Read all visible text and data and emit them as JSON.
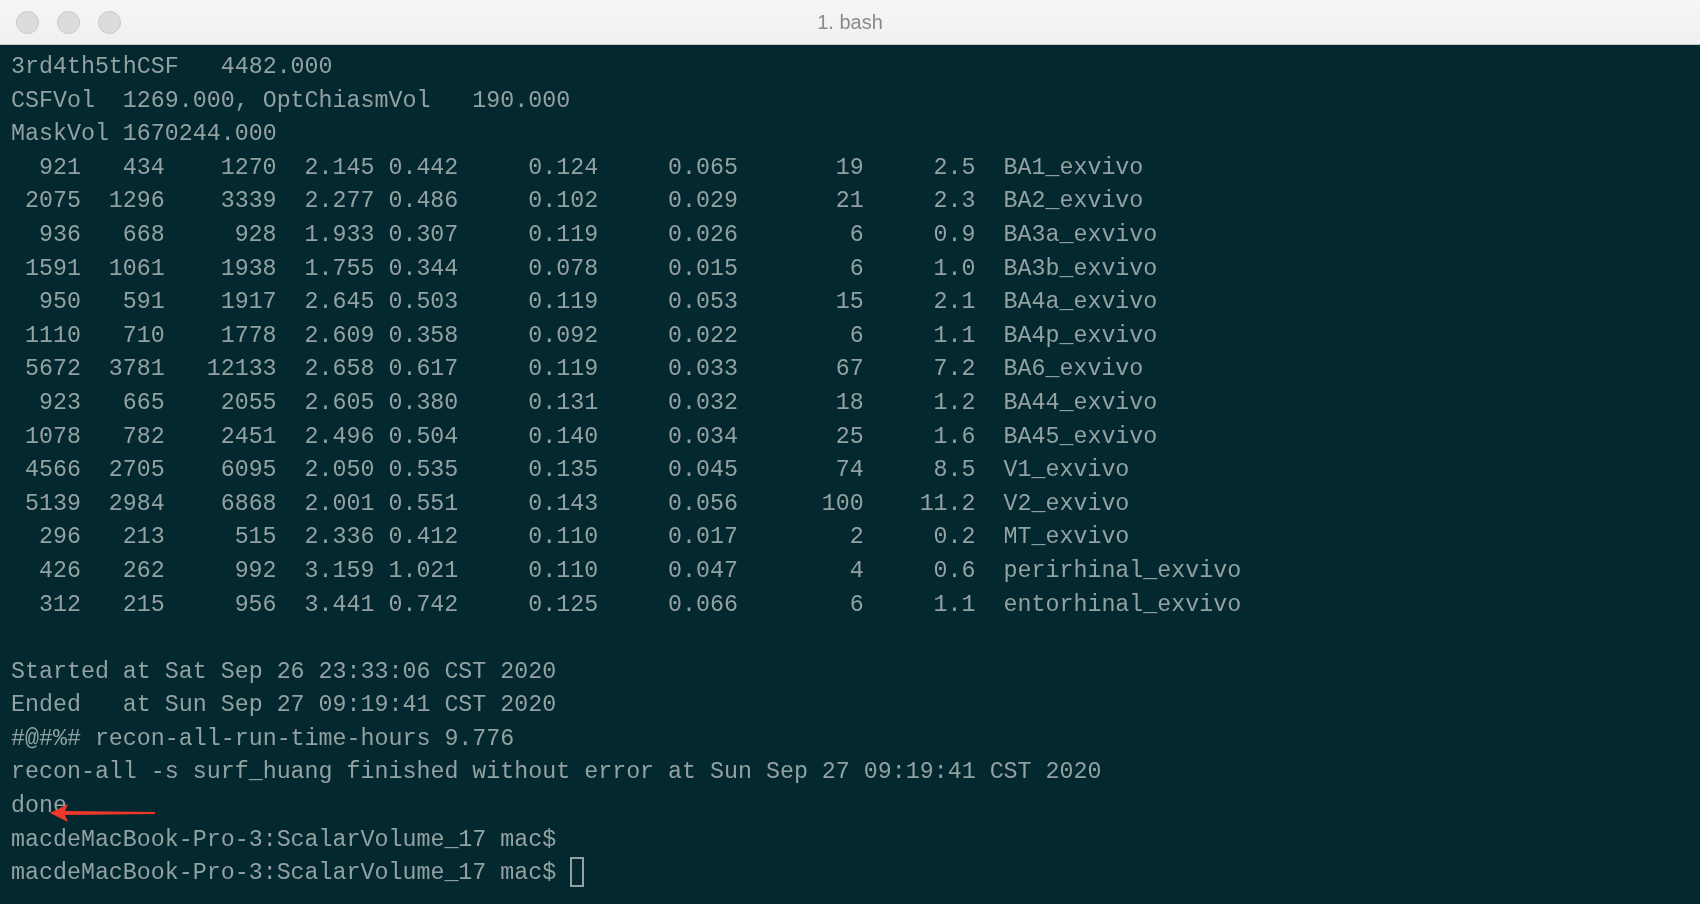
{
  "window": {
    "title": "1. bash"
  },
  "header_lines": [
    "3rd4th5thCSF   4482.000",
    "CSFVol  1269.000, OptChiasmVol   190.000",
    "MaskVol 1670244.000"
  ],
  "table_rows": [
    {
      "cells": [
        "921",
        "434",
        "1270",
        "2.145",
        "0.442",
        "0.124",
        "0.065",
        "19",
        "2.5",
        "BA1_exvivo"
      ]
    },
    {
      "cells": [
        "2075",
        "1296",
        "3339",
        "2.277",
        "0.486",
        "0.102",
        "0.029",
        "21",
        "2.3",
        "BA2_exvivo"
      ]
    },
    {
      "cells": [
        "936",
        "668",
        "928",
        "1.933",
        "0.307",
        "0.119",
        "0.026",
        "6",
        "0.9",
        "BA3a_exvivo"
      ]
    },
    {
      "cells": [
        "1591",
        "1061",
        "1938",
        "1.755",
        "0.344",
        "0.078",
        "0.015",
        "6",
        "1.0",
        "BA3b_exvivo"
      ]
    },
    {
      "cells": [
        "950",
        "591",
        "1917",
        "2.645",
        "0.503",
        "0.119",
        "0.053",
        "15",
        "2.1",
        "BA4a_exvivo"
      ]
    },
    {
      "cells": [
        "1110",
        "710",
        "1778",
        "2.609",
        "0.358",
        "0.092",
        "0.022",
        "6",
        "1.1",
        "BA4p_exvivo"
      ]
    },
    {
      "cells": [
        "5672",
        "3781",
        "12133",
        "2.658",
        "0.617",
        "0.119",
        "0.033",
        "67",
        "7.2",
        "BA6_exvivo"
      ]
    },
    {
      "cells": [
        "923",
        "665",
        "2055",
        "2.605",
        "0.380",
        "0.131",
        "0.032",
        "18",
        "1.2",
        "BA44_exvivo"
      ]
    },
    {
      "cells": [
        "1078",
        "782",
        "2451",
        "2.496",
        "0.504",
        "0.140",
        "0.034",
        "25",
        "1.6",
        "BA45_exvivo"
      ]
    },
    {
      "cells": [
        "4566",
        "2705",
        "6095",
        "2.050",
        "0.535",
        "0.135",
        "0.045",
        "74",
        "8.5",
        "V1_exvivo"
      ]
    },
    {
      "cells": [
        "5139",
        "2984",
        "6868",
        "2.001",
        "0.551",
        "0.143",
        "0.056",
        "100",
        "11.2",
        "V2_exvivo"
      ]
    },
    {
      "cells": [
        "296",
        "213",
        "515",
        "2.336",
        "0.412",
        "0.110",
        "0.017",
        "2",
        "0.2",
        "MT_exvivo"
      ]
    },
    {
      "cells": [
        "426",
        "262",
        "992",
        "3.159",
        "1.021",
        "0.110",
        "0.047",
        "4",
        "0.6",
        "perirhinal_exvivo"
      ]
    },
    {
      "cells": [
        "312",
        "215",
        "956",
        "3.441",
        "0.742",
        "0.125",
        "0.066",
        "6",
        "1.1",
        "entorhinal_exvivo"
      ]
    }
  ],
  "footer_lines": [
    "Started at Sat Sep 26 23:33:06 CST 2020",
    "Ended   at Sun Sep 27 09:19:41 CST 2020",
    "#@#%# recon-all-run-time-hours 9.776",
    "recon-all -s surf_huang finished without error at Sun Sep 27 09:19:41 CST 2020",
    "done"
  ],
  "prompt_lines": [
    {
      "text": "macdeMacBook-Pro-3:ScalarVolume_17 mac$",
      "cursor": false
    },
    {
      "text": "macdeMacBook-Pro-3:ScalarVolume_17 mac$",
      "cursor": true
    }
  ]
}
